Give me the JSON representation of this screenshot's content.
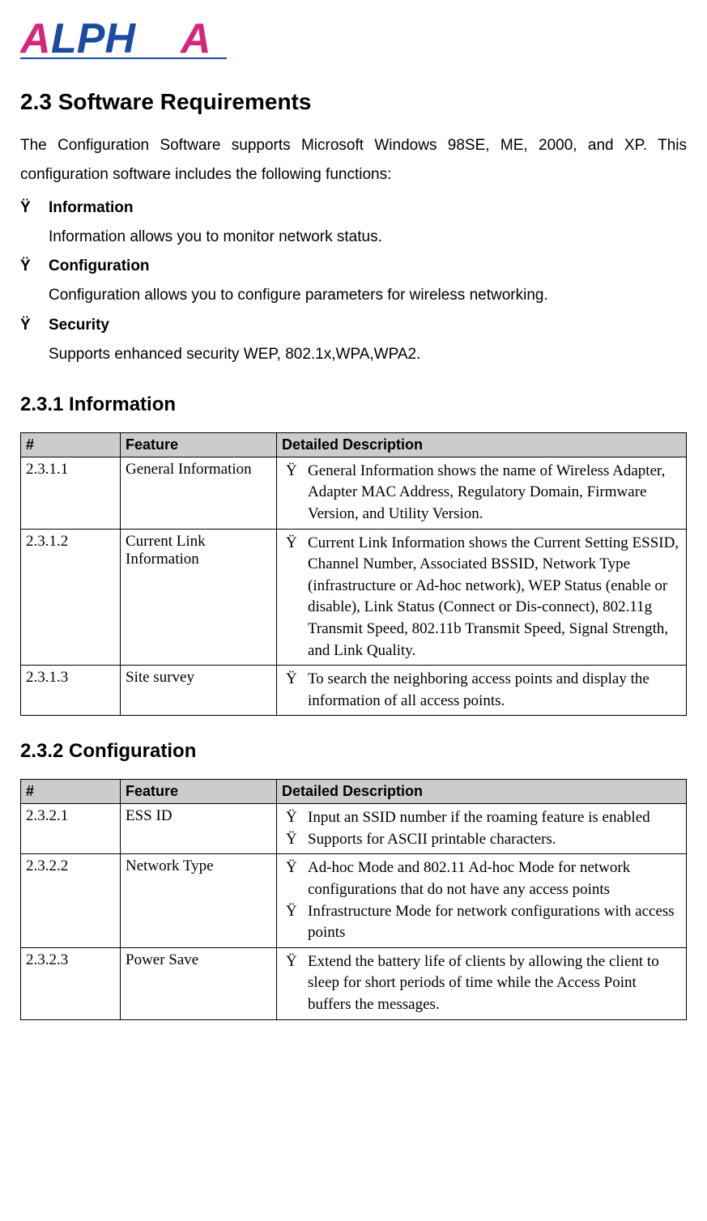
{
  "logo": {
    "text": "ALPHA"
  },
  "heading23": "2.3 Software Requirements",
  "intro": "The Configuration Software supports Microsoft Windows 98SE, ME, 2000, and XP. This configuration software includes the following functions:",
  "features": [
    {
      "title": "Information",
      "desc": "Information allows you to monitor network status."
    },
    {
      "title": "Configuration",
      "desc": "Configuration allows you to configure parameters for wireless networking."
    },
    {
      "title": "Security",
      "desc": "Supports enhanced security WEP, 802.1x,WPA,WPA2."
    }
  ],
  "heading231": "2.3.1 Information",
  "table1": {
    "headers": {
      "num": "#",
      "feature": "Feature",
      "desc": "Detailed Description"
    },
    "rows": [
      {
        "num": "2.3.1.1",
        "feature": "General Information",
        "bullets": [
          "General Information shows the name of Wireless Adapter, Adapter MAC Address, Regulatory Domain, Firmware Version, and Utility Version."
        ]
      },
      {
        "num": "2.3.1.2",
        "feature": "Current Link Information",
        "bullets": [
          "Current Link Information shows the Current Setting ESSID, Channel Number, Associated BSSID, Network Type (infrastructure or Ad-hoc network), WEP Status (enable or disable), Link Status (Connect or Dis-connect), 802.11g Transmit Speed, 802.11b Transmit Speed, Signal Strength, and Link Quality."
        ]
      },
      {
        "num": "2.3.1.3",
        "feature": "Site survey",
        "bullets": [
          "To search the neighboring access points and display the information of all access points."
        ]
      }
    ]
  },
  "heading232": "2.3.2 Configuration",
  "table2": {
    "headers": {
      "num": "#",
      "feature": "Feature",
      "desc": "Detailed Description"
    },
    "rows": [
      {
        "num": "2.3.2.1",
        "feature": "ESS ID",
        "bullets": [
          "Input an SSID number if the roaming feature is enabled",
          "Supports for ASCII printable characters."
        ]
      },
      {
        "num": "2.3.2.2",
        "feature": "Network Type",
        "bullets": [
          "Ad-hoc Mode and 802.11 Ad-hoc Mode for network configurations that do not have any access points",
          "Infrastructure Mode for network configurations with access points"
        ]
      },
      {
        "num": "2.3.2.3",
        "feature": "Power Save",
        "bullets": [
          "Extend the battery life of clients by allowing the client to sleep for short periods of time while the Access Point buffers the messages."
        ]
      }
    ]
  }
}
